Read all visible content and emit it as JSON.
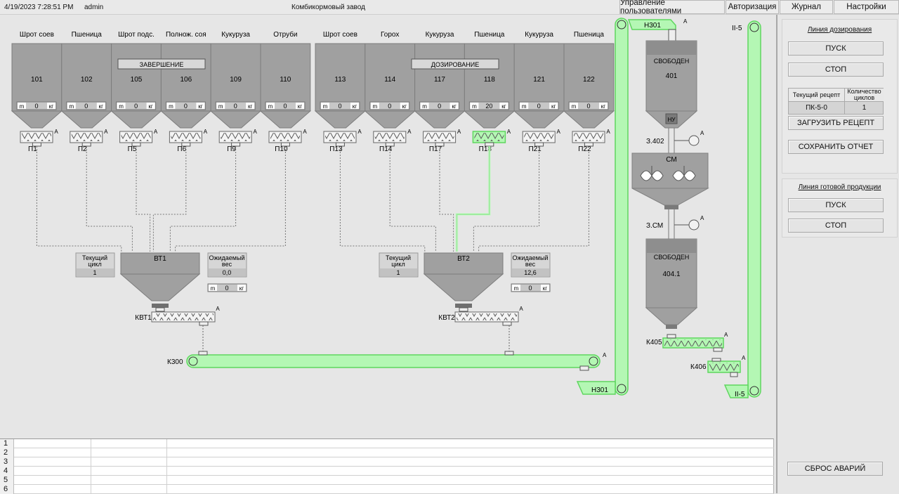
{
  "header": {
    "datetime": "4/19/2023 7:28:51 PM",
    "user": "admin",
    "title": "Комбикормовый завод",
    "menu": [
      "Управление пользователями",
      "Авторизация",
      "Журнал",
      "Настройки"
    ]
  },
  "colors": {
    "accent": "#b4f7b4",
    "accent_stroke": "#5fd65f",
    "equipment": "#a0a0a0",
    "equipment_dark": "#8a8a8a",
    "background": "#e6e6e6"
  },
  "bins_left": [
    {
      "product": "Шрот соев",
      "id": "101",
      "unit_m": "m",
      "value": "0",
      "unit_kg": "кг",
      "feeder": "П1"
    },
    {
      "product": "Пшеница",
      "id": "102",
      "unit_m": "m",
      "value": "0",
      "unit_kg": "кг",
      "feeder": "П2"
    },
    {
      "product": "Шрот подс.",
      "id": "105",
      "unit_m": "m",
      "value": "0",
      "unit_kg": "кг",
      "feeder": "П5"
    },
    {
      "product": "Полнож. соя",
      "id": "106",
      "unit_m": "m",
      "value": "0",
      "unit_kg": "кг",
      "feeder": "П6"
    },
    {
      "product": "Кукуруза",
      "id": "109",
      "unit_m": "m",
      "value": "0",
      "unit_kg": "кг",
      "feeder": "П9"
    },
    {
      "product": "Отруби",
      "id": "110",
      "unit_m": "m",
      "value": "0",
      "unit_kg": "кг",
      "feeder": "П10"
    }
  ],
  "bins_right": [
    {
      "product": "Шрот соев",
      "id": "113",
      "unit_m": "m",
      "value": "0",
      "unit_kg": "кг",
      "feeder": "П13"
    },
    {
      "product": "Горох",
      "id": "114",
      "unit_m": "m",
      "value": "0",
      "unit_kg": "кг",
      "feeder": "П14"
    },
    {
      "product": "Кукуруза",
      "id": "117",
      "unit_m": "m",
      "value": "0",
      "unit_kg": "кг",
      "feeder": "П17"
    },
    {
      "product": "Пшеница",
      "id": "118",
      "unit_m": "m",
      "value": "20",
      "unit_kg": "кг",
      "feeder": "П18",
      "active": true
    },
    {
      "product": "Кукуруза",
      "id": "121",
      "unit_m": "m",
      "value": "0",
      "unit_kg": "кг",
      "feeder": "П21"
    },
    {
      "product": "Пшеница",
      "id": "122",
      "unit_m": "m",
      "value": "0",
      "unit_kg": "кг",
      "feeder": "П22"
    }
  ],
  "group_status": {
    "left": "ЗАВЕРШЕНИЕ",
    "right": "ДОЗИРОВАНИЕ"
  },
  "auto_marker": "A",
  "scales": [
    {
      "id": "ВТ1",
      "cycle_label": "Текущий цикл",
      "cycle_value": "1",
      "expected_label": "Ожидаемый вес",
      "expected_value": "0,0",
      "unit_m": "m",
      "weight": "0",
      "unit_kg": "кг",
      "screw": "КВТ1"
    },
    {
      "id": "ВТ2",
      "cycle_label": "Текущий цикл",
      "cycle_value": "1",
      "expected_label": "Ожидаемый вес",
      "expected_value": "12,6",
      "unit_m": "m",
      "weight": "0",
      "unit_kg": "кг",
      "screw": "КВТ2"
    }
  ],
  "conveyor": "К300",
  "elevator_bottom": "Н301",
  "elevator_top": "Н301",
  "elevator2_top": "II-5",
  "elevator2_bottom": "II-5",
  "bin401": {
    "status": "СВОБОДЕН",
    "id": "401",
    "level": "НУ"
  },
  "valve_402": "З.402",
  "mixer": "СМ",
  "valve_sm": "З.СМ",
  "bin404": {
    "status": "СВОБОДЕН",
    "id": "404.1"
  },
  "conveyor_k405": "К405",
  "conveyor_k406": "К406",
  "sidebar": {
    "dosing_title": "Линия дозирования",
    "start": "ПУСК",
    "stop": "СТОП",
    "recipe_header": "Текущий рецепт",
    "cycles_header": "Количество циклов",
    "recipe_value": "ПК-5-0",
    "cycles_value": "1",
    "load_recipe": "ЗАГРУЗИТЬ РЕЦЕПТ",
    "save_report": "СОХРАНИТЬ ОТЧЕТ",
    "finished_title": "Линия готовой продукции",
    "start2": "ПУСК",
    "stop2": "СТОП",
    "reset_alarms": "СБРОС АВАРИЙ"
  },
  "log_rows": [
    "1",
    "2",
    "3",
    "4",
    "5",
    "6"
  ]
}
